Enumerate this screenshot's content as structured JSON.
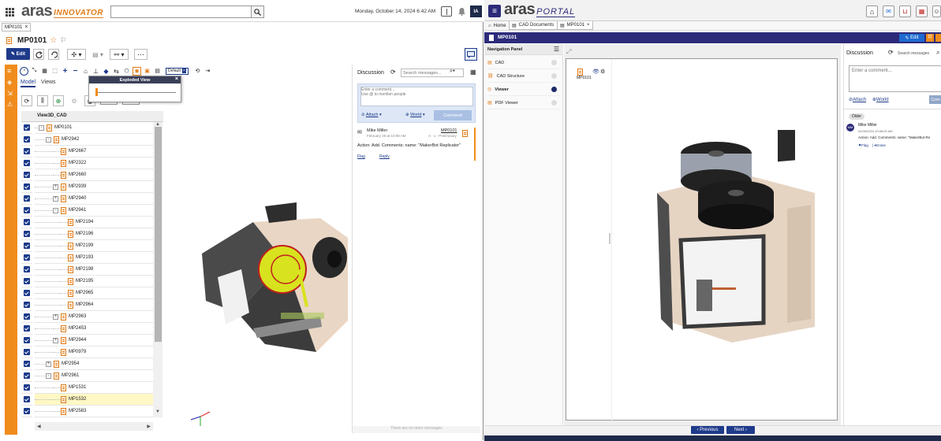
{
  "left": {
    "logo_main": "aras",
    "logo_sub": "INNOVATOR",
    "date": "Monday, October 14, 2024 6:42 AM",
    "user_initials": "IA",
    "tab_label": "MP0101",
    "item_title": "MP0101",
    "edit_label": "Edit",
    "default_label": "Default",
    "exploded_view_title": "Exploded View",
    "model_tab": "Model",
    "views_tab": "Views",
    "column_header": "View3D_CAD",
    "discussion": {
      "title": "Discussion",
      "search_placeholder": "Search messages...",
      "comment_placeholder": "Enter a comment...\nUse @ to mention people",
      "attach": "Attach",
      "world": "World",
      "comment_button": "Comment",
      "author": "Mike Miller",
      "date": "February 26 at 10:08 AM",
      "item_ref": "MP0101",
      "item_rev": "A - 1 - Preliminary",
      "message": "Action: Add. Comments: name: \"MakerBot Replicator\"",
      "flag": "Flag",
      "reply": "Reply",
      "footer": "There are no more messages"
    },
    "tree": [
      {
        "label": "MP0101",
        "level": 0,
        "expander": "-"
      },
      {
        "label": "MP2942",
        "level": 1,
        "expander": "-"
      },
      {
        "label": "MP2667",
        "level": 2,
        "expander": ""
      },
      {
        "label": "MP2322",
        "level": 2,
        "expander": ""
      },
      {
        "label": "MP2660",
        "level": 2,
        "expander": ""
      },
      {
        "label": "MP2939",
        "level": 2,
        "expander": "+"
      },
      {
        "label": "MP2940",
        "level": 2,
        "expander": "+"
      },
      {
        "label": "MP2941",
        "level": 2,
        "expander": "-"
      },
      {
        "label": "MP2194",
        "level": 3,
        "expander": ""
      },
      {
        "label": "MP2196",
        "level": 3,
        "expander": ""
      },
      {
        "label": "MP2199",
        "level": 3,
        "expander": ""
      },
      {
        "label": "MP2193",
        "level": 3,
        "expander": ""
      },
      {
        "label": "MP2198",
        "level": 3,
        "expander": ""
      },
      {
        "label": "MP2195",
        "level": 3,
        "expander": ""
      },
      {
        "label": "MP2965",
        "level": 3,
        "expander": ""
      },
      {
        "label": "MP2964",
        "level": 3,
        "expander": ""
      },
      {
        "label": "MP2963",
        "level": 2,
        "expander": "+"
      },
      {
        "label": "MP2453",
        "level": 2,
        "expander": ""
      },
      {
        "label": "MP2944",
        "level": 2,
        "expander": "+"
      },
      {
        "label": "MP0979",
        "level": 2,
        "expander": ""
      },
      {
        "label": "MP2954",
        "level": 1,
        "expander": "+"
      },
      {
        "label": "MP2961",
        "level": 1,
        "expander": "-"
      },
      {
        "label": "MP1531",
        "level": 2,
        "expander": ""
      },
      {
        "label": "MP1532",
        "level": 2,
        "expander": "",
        "selected": true
      },
      {
        "label": "MP2583",
        "level": 2,
        "expander": ""
      }
    ],
    "colors": {
      "accent": "#f08c1e",
      "checkbox": "#1a3a8a",
      "selected_row": "#fff8c4"
    }
  },
  "right": {
    "logo_main": "aras",
    "logo_sub": "PORTAL",
    "breadcrumbs": [
      "Home",
      "CAD Documents",
      "MP0101"
    ],
    "item_title": "MP0101",
    "edit_label": "Edit",
    "nav_panel_title": "Navigation Panel",
    "nav_items": [
      {
        "label": "CAD",
        "active": false
      },
      {
        "label": "CAD Structure",
        "active": false
      },
      {
        "label": "Viewer",
        "active": true
      },
      {
        "label": "PDF Viewer",
        "active": false
      }
    ],
    "viewer_item": "MP0101",
    "discussion": {
      "title": "Discussion",
      "search_placeholder": "Search messages",
      "comment_placeholder": "Enter a comment...",
      "attach": "Attach",
      "world": "World",
      "comment_button": "Com",
      "older": "Older",
      "author": "Mike Miller",
      "date": "02/26/2024 10:08:00 AM",
      "message": "Action: Add. Comments: name: \"MakerBot Re",
      "flag": "Flag",
      "erase": "Erase",
      "avatar": "MM"
    },
    "previous": "Previous",
    "next": "Next",
    "colors": {
      "header_bar": "#2c2b7a",
      "button": "#1e3a8a"
    }
  }
}
